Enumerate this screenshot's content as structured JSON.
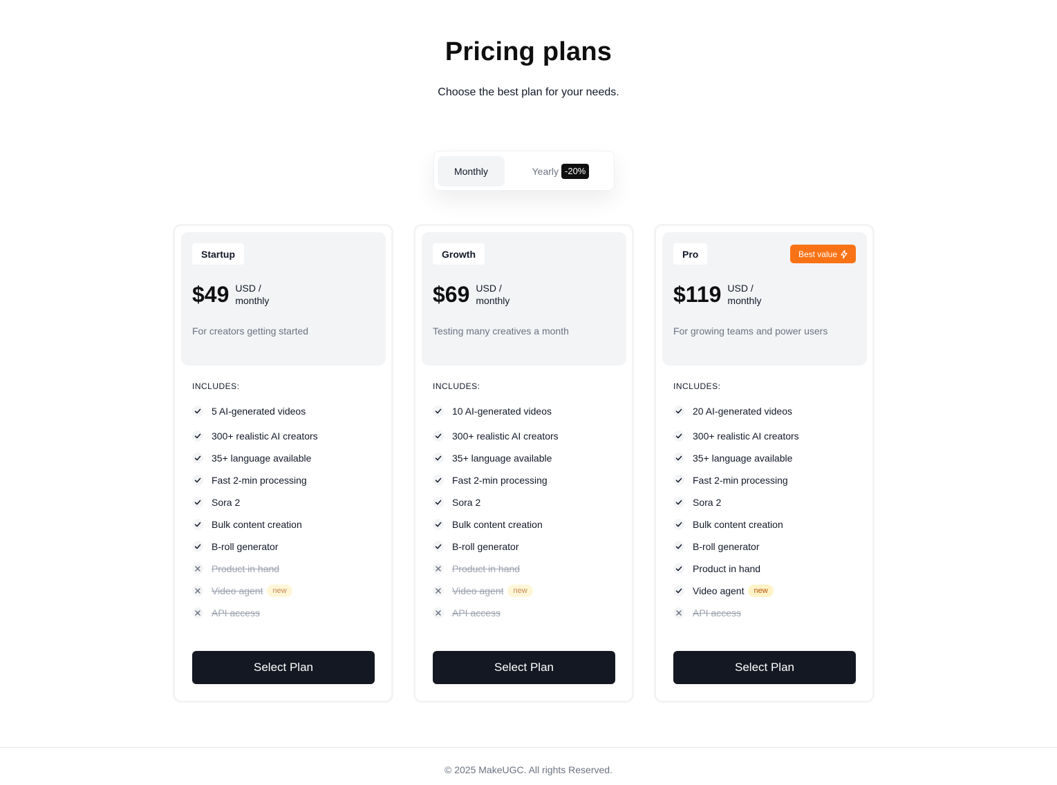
{
  "header": {
    "title": "Pricing plans",
    "subtitle": "Choose the best plan for your needs."
  },
  "billing_toggle": {
    "monthly_label": "Monthly",
    "yearly_label": "Yearly",
    "yearly_discount": "-20%",
    "selected": "Monthly"
  },
  "includes_label": "INCLUDES:",
  "plans": [
    {
      "name": "Startup",
      "price": "$49",
      "unit_line1": "USD /",
      "unit_line2": "monthly",
      "description": "For creators getting started",
      "features": [
        {
          "label": "5 AI-generated videos",
          "included": true
        },
        {
          "label": "300+ realistic AI creators",
          "included": true
        },
        {
          "label": "35+ language available",
          "included": true
        },
        {
          "label": "Fast 2-min processing",
          "included": true
        },
        {
          "label": "Sora 2",
          "included": true
        },
        {
          "label": "Bulk content creation",
          "included": true
        },
        {
          "label": "B-roll generator",
          "included": true
        },
        {
          "label": "Product in hand",
          "included": false
        },
        {
          "label": "Video agent",
          "included": false,
          "tag": "new"
        },
        {
          "label": "API access",
          "included": false
        }
      ],
      "button": "Select Plan"
    },
    {
      "name": "Growth",
      "price": "$69",
      "unit_line1": "USD /",
      "unit_line2": "monthly",
      "description": "Testing many creatives a month",
      "features": [
        {
          "label": "10 AI-generated videos",
          "included": true
        },
        {
          "label": "300+ realistic AI creators",
          "included": true
        },
        {
          "label": "35+ language available",
          "included": true
        },
        {
          "label": "Fast 2-min processing",
          "included": true
        },
        {
          "label": "Sora 2",
          "included": true
        },
        {
          "label": "Bulk content creation",
          "included": true
        },
        {
          "label": "B-roll generator",
          "included": true
        },
        {
          "label": "Product in hand",
          "included": false
        },
        {
          "label": "Video agent",
          "included": false,
          "tag": "new"
        },
        {
          "label": "API access",
          "included": false
        }
      ],
      "button": "Select Plan"
    },
    {
      "name": "Pro",
      "badge": "Best value",
      "badge_icon": "lightning-icon",
      "price": "$119",
      "unit_line1": "USD /",
      "unit_line2": "monthly",
      "description": "For growing teams and power users",
      "features": [
        {
          "label": "20 AI-generated videos",
          "included": true
        },
        {
          "label": "300+ realistic AI creators",
          "included": true
        },
        {
          "label": "35+ language available",
          "included": true
        },
        {
          "label": "Fast 2-min processing",
          "included": true
        },
        {
          "label": "Sora 2",
          "included": true
        },
        {
          "label": "Bulk content creation",
          "included": true
        },
        {
          "label": "B-roll generator",
          "included": true
        },
        {
          "label": "Product in hand",
          "included": true
        },
        {
          "label": "Video agent",
          "included": true,
          "tag": "new"
        },
        {
          "label": "API access",
          "included": false
        }
      ],
      "button": "Select Plan"
    }
  ],
  "footer": {
    "copyright": "© 2025 MakeUGC. All rights Reserved."
  },
  "colors": {
    "accent_orange": "#f97316",
    "button_dark": "#141822",
    "panel_gray": "#f3f4f6",
    "new_tag_bg": "#fef3c7"
  },
  "icons": [
    "check-icon",
    "x-icon",
    "lightning-icon"
  ]
}
